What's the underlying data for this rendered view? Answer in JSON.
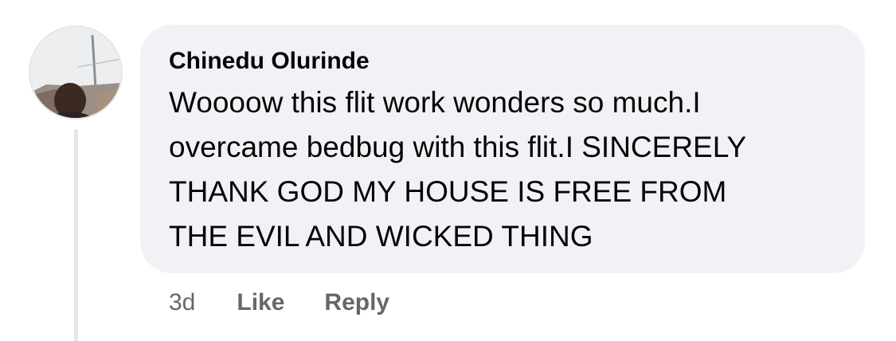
{
  "comment": {
    "author": "Chinedu Olurinde",
    "text": "Woooow this flit work wonders so much.I\novercame bedbug with this flit.I SINCERELY\nTHANK GOD MY HOUSE IS FREE FROM\nTHE EVIL AND WICKED THING",
    "timestamp": "3d",
    "like_label": "Like",
    "reply_label": "Reply"
  },
  "colors": {
    "bubble_bg": "#f0f2f5",
    "text": "#050505",
    "meta_text": "#65676b",
    "thread_line": "#e4e6eb"
  }
}
